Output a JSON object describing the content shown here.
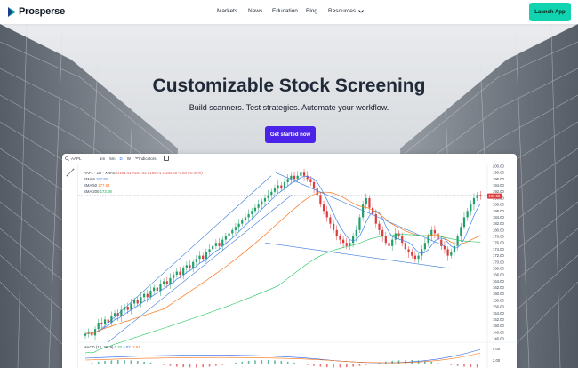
{
  "brand": {
    "name": "Prosperse"
  },
  "nav": {
    "links": [
      "Markets",
      "News",
      "Education",
      "Blog",
      "Resources"
    ],
    "cta": "Launch App"
  },
  "hero": {
    "title": "Customizable Stock Screening",
    "subtitle": "Build scanners. Test strategies. Automate your workflow.",
    "button": "Get started now"
  },
  "chart_widget": {
    "symbol": "AAPL",
    "timeframes": [
      "1m",
      "5m",
      "D",
      "W"
    ],
    "active_timeframe": "D",
    "indicators_label": "Indicators",
    "legend": {
      "title": "AAPL · 1D · XNAS",
      "ohlc": "O191.41 H191.92 L189.74 C190.65 -0.85 (-0.44%)",
      "sma9": "SMA 9",
      "sma9_val": "187.80",
      "sma50": "SMA 50",
      "sma50_val": "177.64",
      "sma200": "SMA 200",
      "sma200_val": "173.08"
    },
    "macd": {
      "label": "MACD (12, 26, 9)",
      "v1": "1.32",
      "v2": "4.07",
      "v3": "-2.84"
    },
    "last_price": "190.65",
    "macd_axis": [
      "4.00",
      "2.00"
    ]
  },
  "chart_data": {
    "type": "candlestick",
    "y_axis_ticks": [
      "200.00",
      "198.00",
      "196.00",
      "194.00",
      "192.00",
      "190.00",
      "188.00",
      "186.00",
      "184.00",
      "182.00",
      "180.00",
      "178.00",
      "176.00",
      "174.00",
      "172.00",
      "170.00",
      "168.00",
      "166.00",
      "164.00",
      "162.00",
      "160.00",
      "158.00",
      "156.00",
      "154.00",
      "152.00",
      "150.00",
      "148.00",
      "146.00"
    ],
    "ylim": [
      146,
      200
    ],
    "closes": [
      147.5,
      148,
      147,
      149,
      151,
      150.5,
      152,
      151,
      153,
      154,
      153,
      155,
      156,
      155,
      157,
      158,
      157,
      159,
      160,
      159,
      161,
      162,
      161,
      163,
      164,
      163,
      165,
      166,
      167,
      166,
      168,
      169,
      168,
      170,
      171,
      172,
      171,
      173,
      174,
      175,
      176,
      175,
      177,
      178,
      179,
      180,
      181,
      182,
      183,
      184,
      185,
      186,
      187,
      188,
      189,
      190,
      191,
      192,
      193,
      194,
      193,
      195,
      196,
      197,
      196,
      197,
      198,
      197,
      196,
      195,
      193,
      191,
      188,
      186,
      184,
      182,
      180,
      178,
      177,
      176,
      175,
      176,
      178,
      180,
      184,
      188,
      190,
      187,
      185,
      182,
      180,
      178,
      176,
      175,
      177,
      179,
      178,
      176,
      174,
      173,
      172,
      171,
      172,
      174,
      176,
      178,
      180,
      179,
      177,
      175,
      174,
      172,
      173,
      175,
      178,
      181,
      184,
      186,
      188,
      190,
      191,
      190.65
    ],
    "sma9_label": "SMA 9",
    "sma50_label": "SMA 50",
    "sma200_label": "SMA 200"
  }
}
